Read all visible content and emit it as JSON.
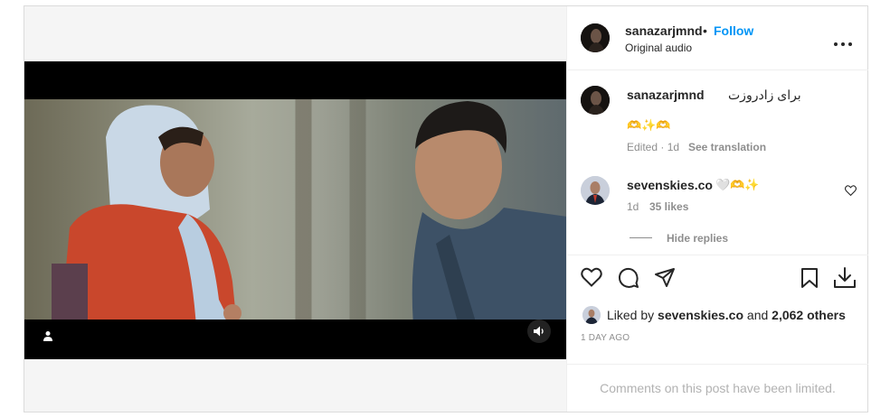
{
  "post": {
    "author": "sanazarjmnd",
    "follow_label": "Follow",
    "separator": "•",
    "audio_label": "Original audio",
    "more_label": "•••"
  },
  "caption": {
    "author": "sanazarjmnd",
    "text": "برای زادروزت",
    "emojis": "🫶✨🫶",
    "edited_label": "Edited · 1d",
    "translation_label": "See translation"
  },
  "comment": {
    "author": "sevenskies.co",
    "text": "🤍🫶✨",
    "time": "1d",
    "likes": "35 likes"
  },
  "replies": {
    "hide_label": "Hide replies"
  },
  "likes": {
    "prefix": "Liked by",
    "user": "sevenskies.co",
    "middle": "and",
    "count": "2,062 others"
  },
  "timestamp": "1 DAY AGO",
  "comments_limited": "Comments on this post have been limited.",
  "icons": {
    "like": "heart-icon",
    "comment": "comment-icon",
    "share": "send-icon",
    "save": "bookmark-icon",
    "download": "download-icon",
    "tag": "user-tag-icon",
    "audio": "speaker-icon",
    "comment_like": "small-heart-icon"
  },
  "colors": {
    "accent": "#0095f6",
    "text": "#262626",
    "secondary": "#8e8e8e"
  }
}
